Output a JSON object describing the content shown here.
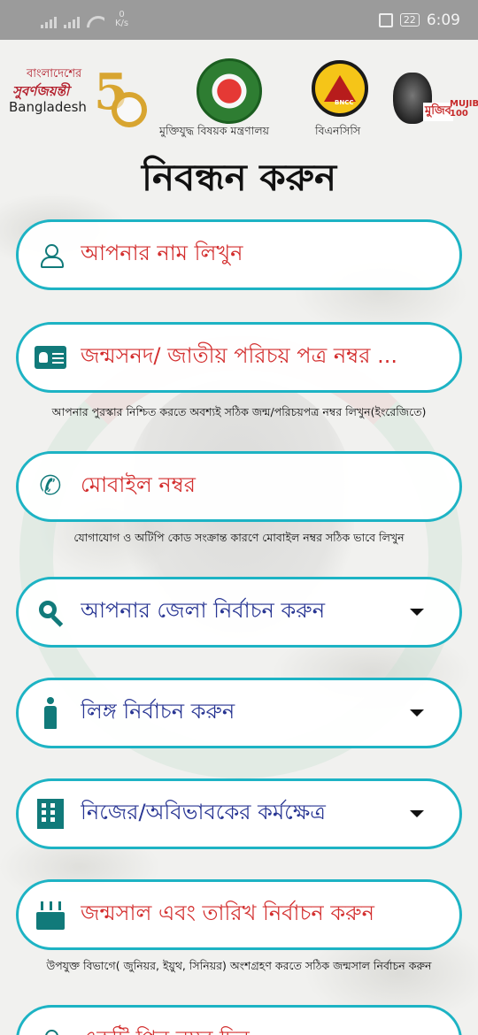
{
  "status_bar": {
    "speed_value": "0",
    "speed_unit": "K/s",
    "battery": "22",
    "time": "6:09"
  },
  "header": {
    "golden_jubilee": {
      "line1": "বাংলাদেশের",
      "line2": "সুবর্ণজয়ন্তী",
      "line3": "Bangladesh",
      "numeral": "5"
    },
    "ministry_label": "মুক্তিযুদ্ধ বিষয়ক মন্ত্রণালয়",
    "bncc_badge": "BNCC",
    "bncc_label": "বিএনসিসি",
    "mujib_logo_text": "মুজিব",
    "mujib_logo_100": "MUJIB 100"
  },
  "page_title": "নিবন্ধন করুন",
  "form": {
    "name": {
      "placeholder": "আপনার নাম লিখুন",
      "icon": "person-icon"
    },
    "nid": {
      "placeholder": "জন্মসনদ/ জাতীয় পরিচয় পত্র নম্বর ...",
      "icon": "id-card-icon",
      "hint": "আপনার পুরস্কার নিশ্চিত করতে অবশ্যই সঠিক জন্ম/পরিচয়পত্র নম্বর লিখুন(ইংরেজিতে)"
    },
    "mobile": {
      "placeholder": "মোবাইল নম্বর",
      "icon": "phone-icon",
      "hint": "যোগাযোগ ও অটিপি কোড সংক্রান্ত কারণে মোবাইল নম্বর সঠিক ভাবে লিখুন"
    },
    "district": {
      "placeholder": "আপনার জেলা নির্বাচন করুন",
      "icon": "location-search-icon"
    },
    "gender": {
      "placeholder": "লিঙ্গ নির্বাচন করুন",
      "icon": "person-standing-icon"
    },
    "occupation": {
      "placeholder": "নিজের/অবিভাবকের কর্মক্ষেত্র",
      "icon": "building-icon"
    },
    "birth": {
      "placeholder": "জন্মসাল এবং তারিখ নির্বাচন করুন",
      "icon": "cake-icon",
      "hint": "উপযুক্ত বিভাগে( জুনিয়র, ইয়ুথ, সিনিয়র) অংশগ্রহণ করতে সঠিক জন্মসাল নির্বাচন করুন"
    },
    "pin": {
      "placeholder": "একটি পিন নম্বর দিন",
      "icon": "lock-icon"
    }
  }
}
